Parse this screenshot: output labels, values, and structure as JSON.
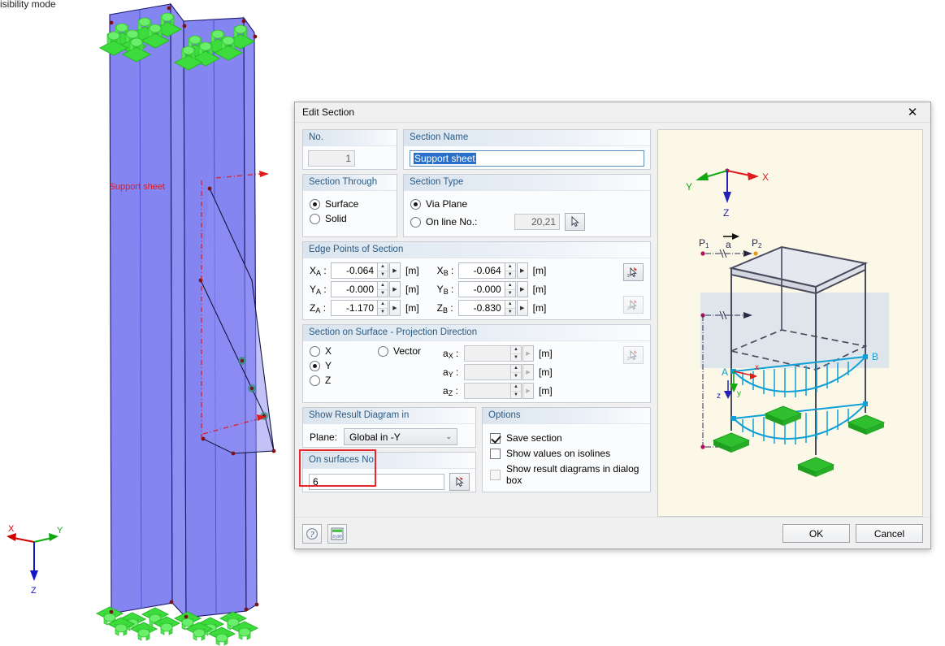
{
  "app": {
    "status_text": "isibility mode"
  },
  "model": {
    "section_label": "Support sheet",
    "axes": {
      "x": "X",
      "y": "Y",
      "z": "Z"
    }
  },
  "dialog": {
    "title": "Edit Section",
    "close_icon": "close-icon",
    "no_group": {
      "title": "No.",
      "value": "1"
    },
    "name_group": {
      "title": "Section Name",
      "value": "Support sheet"
    },
    "section_through": {
      "title": "Section Through",
      "options": [
        {
          "label": "Surface",
          "selected": true
        },
        {
          "label": "Solid",
          "selected": false
        }
      ]
    },
    "section_type": {
      "title": "Section Type",
      "options": [
        {
          "label": "Via Plane",
          "selected": true
        },
        {
          "label": "On line No.:",
          "selected": false
        }
      ],
      "line_no_value": "20,21",
      "pick_icon": "pick-cursor-icon"
    },
    "edge_points": {
      "title": "Edge Points of Section",
      "unit": "[m]",
      "rows": [
        {
          "label_a": "X",
          "sub_a": "A",
          "value_a": "-0.064",
          "label_b": "X",
          "sub_b": "B",
          "value_b": "-0.064"
        },
        {
          "label_a": "Y",
          "sub_a": "A",
          "value_a": "-0.000",
          "label_b": "Y",
          "sub_b": "B",
          "value_b": "-0.000"
        },
        {
          "label_a": "Z",
          "sub_a": "A",
          "value_a": "-1.170",
          "label_b": "Z",
          "sub_b": "B",
          "value_b": "-0.830"
        }
      ],
      "pick_2d_icon": "pick-2d-icon",
      "pick_3d_icon": "pick-3d-icon"
    },
    "projection": {
      "title": "Section on Surface - Projection Direction",
      "axis_options": [
        {
          "label": "X",
          "selected": false
        },
        {
          "label": "Y",
          "selected": true
        },
        {
          "label": "Z",
          "selected": false
        }
      ],
      "vector_option": {
        "label": "Vector",
        "selected": false
      },
      "unit": "[m]",
      "vector_rows": [
        {
          "label": "a",
          "sub": "X",
          "value": ""
        },
        {
          "label": "a",
          "sub": "Y",
          "value": ""
        },
        {
          "label": "a",
          "sub": "Z",
          "value": ""
        }
      ],
      "pick_icon": "pick-2d-icon"
    },
    "result_diagram": {
      "title": "Show Result Diagram in",
      "plane_label": "Plane:",
      "plane_value": "Global in -Y",
      "chevron_icon": "chevron-down-icon"
    },
    "on_surfaces": {
      "title": "On surfaces No.",
      "value": "6",
      "pick_icon": "pick-cursor-icon",
      "highlight_color": "#e8262b"
    },
    "options": {
      "title": "Options",
      "items": [
        {
          "label": "Save section",
          "checked": true,
          "disabled": false
        },
        {
          "label": "Show values on isolines",
          "checked": false,
          "disabled": false
        },
        {
          "label": "Show result diagrams in dialog box",
          "checked": false,
          "disabled": true
        }
      ]
    },
    "preview": {
      "axes": {
        "x": "X",
        "y": "Y",
        "z": "Z"
      },
      "local_axes": {
        "x": "x",
        "y": "y",
        "z": "z"
      },
      "points": {
        "p1": "P",
        "p1_sub": "1",
        "p2": "P",
        "p2_sub": "2",
        "a": "a",
        "A": "A",
        "B": "B"
      }
    },
    "footer": {
      "help_icon": "help-icon",
      "units_icon": "units-icon",
      "units_label": "0,00",
      "ok_label": "OK",
      "cancel_label": "Cancel"
    }
  }
}
